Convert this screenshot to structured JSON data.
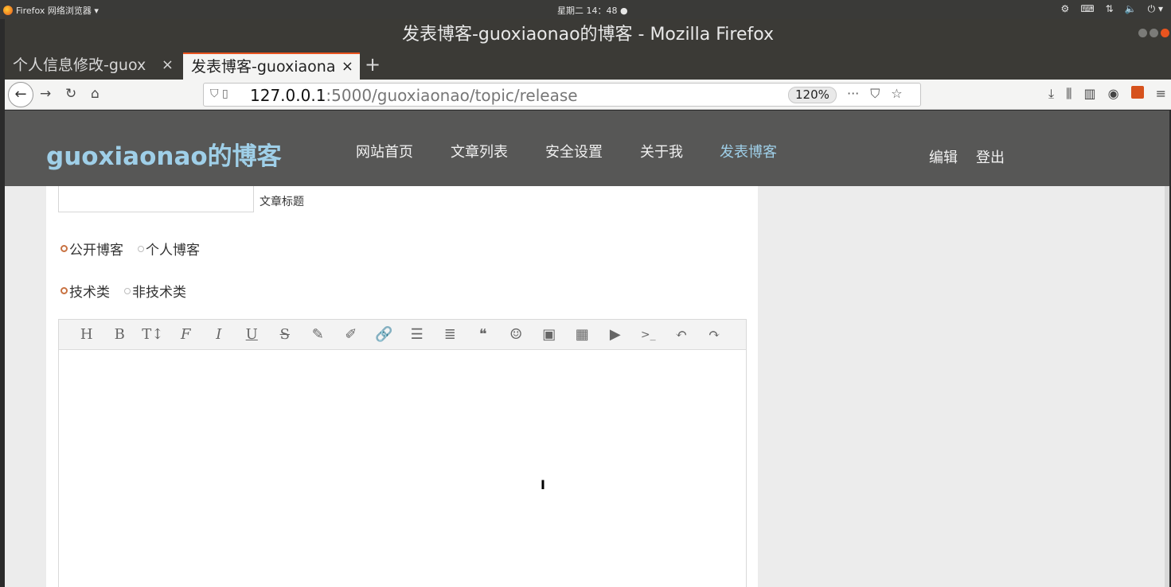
{
  "os": {
    "app_menu": "Firefox 网络浏览器 ▾",
    "clock": "星期二 14：48 ●",
    "tray": [
      "⚙",
      "⌨",
      "⇅",
      "🔈",
      "⏻ ▾"
    ]
  },
  "window": {
    "title": "发表博客-guoxiaonao的博客 - Mozilla Firefox"
  },
  "tabs": [
    {
      "label": "个人信息修改-guox",
      "close": "×"
    },
    {
      "label": "发表博客-guoxiaona",
      "close": "×"
    }
  ],
  "newtab": "+",
  "nav": {
    "back": "←",
    "forward": "→",
    "reload": "↻",
    "home": "⌂",
    "url_host": "127.0.0.1",
    "url_path": ":5000/guoxiaonao/topic/release",
    "zoom": "120%",
    "url_actions": [
      "···",
      "⛉",
      "☆"
    ],
    "toolbar_icons": [
      "⤓",
      "⫼",
      "▥",
      "◉"
    ],
    "menu": "≡"
  },
  "site": {
    "brand": "guoxiaonao的博客",
    "menu": [
      "网站首页",
      "文章列表",
      "安全设置",
      "关于我",
      "发表博客"
    ],
    "edit": "编辑",
    "logout": "登出"
  },
  "form": {
    "title_label": "文章标题",
    "visibility": [
      "公开博客",
      "个人博客"
    ],
    "category": [
      "技术类",
      "非技术类"
    ]
  },
  "editor": {
    "toolbar": [
      "H",
      "B",
      "T↕",
      "F",
      "I",
      "U",
      "S",
      "✎",
      "✐",
      "🔗",
      "☰",
      "≣",
      "❝",
      "☺",
      "▣",
      "▦",
      "▶",
      ">_",
      "↶",
      "↷"
    ],
    "cursor": "I"
  }
}
